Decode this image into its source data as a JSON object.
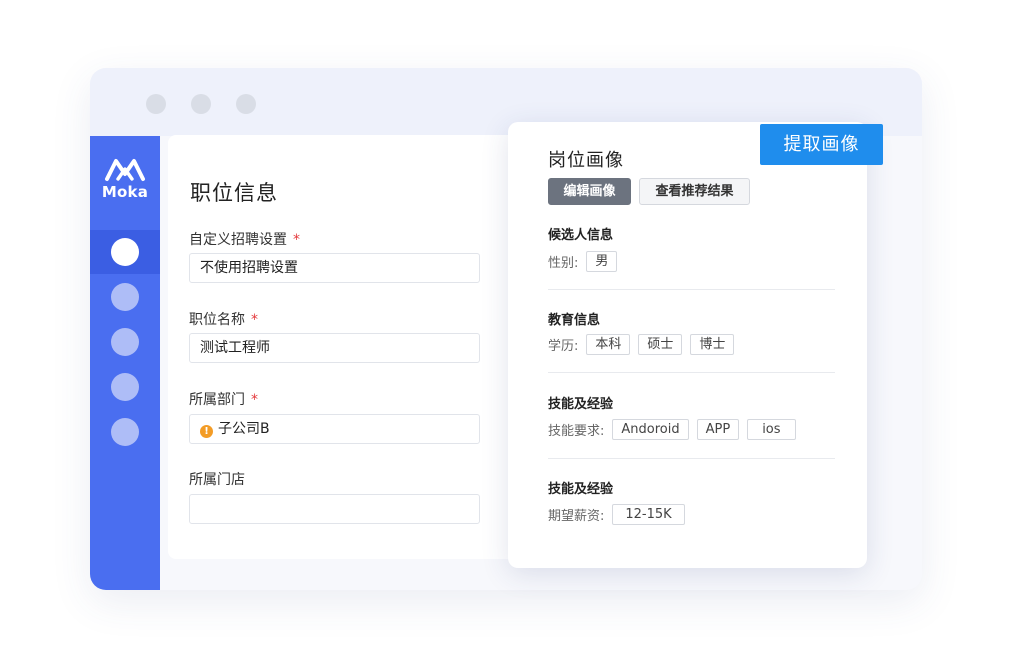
{
  "window": {
    "controls": [
      "window-dot",
      "window-dot",
      "window-dot"
    ]
  },
  "sidebar": {
    "logo_text": "Moka",
    "nav_items": [
      {
        "icon": "nav-circle",
        "active": true
      },
      {
        "icon": "nav-circle",
        "active": false
      },
      {
        "icon": "nav-circle",
        "active": false
      },
      {
        "icon": "nav-circle",
        "active": false
      },
      {
        "icon": "nav-circle",
        "active": false
      }
    ]
  },
  "form": {
    "title": "职位信息",
    "fields": [
      {
        "label": "自定义招聘设置",
        "required_mark": "*",
        "value": "不使用招聘设置"
      },
      {
        "label": "职位名称",
        "required_mark": "*",
        "value": "测试工程师"
      },
      {
        "label": "所属部门",
        "required_mark": "*",
        "value": "子公司B",
        "icon": "warning-icon"
      },
      {
        "label": "所属门店",
        "required_mark": "",
        "value": ""
      }
    ]
  },
  "profile": {
    "title": "岗位画像",
    "edit_button": "编辑画像",
    "view_button": "查看推荐结果",
    "sections": [
      {
        "title": "候选人信息",
        "row_label": "性别:",
        "tags": [
          "男"
        ]
      },
      {
        "title": "教育信息",
        "row_label": "学历:",
        "tags": [
          "本科",
          "硕士",
          "博士"
        ]
      },
      {
        "title": "技能及经验",
        "row_label": "技能要求:",
        "tags": [
          "Andoroid",
          "APP",
          "ios"
        ]
      },
      {
        "title": "技能及经验",
        "row_label": "期望薪资:",
        "tags": [
          "12-15K"
        ]
      }
    ]
  },
  "extract_button": "提取画像",
  "colors": {
    "sidebar": "#4a6ef0",
    "accent_button": "#1f8ded",
    "required": "#e4393c",
    "warning": "#f39c26"
  }
}
